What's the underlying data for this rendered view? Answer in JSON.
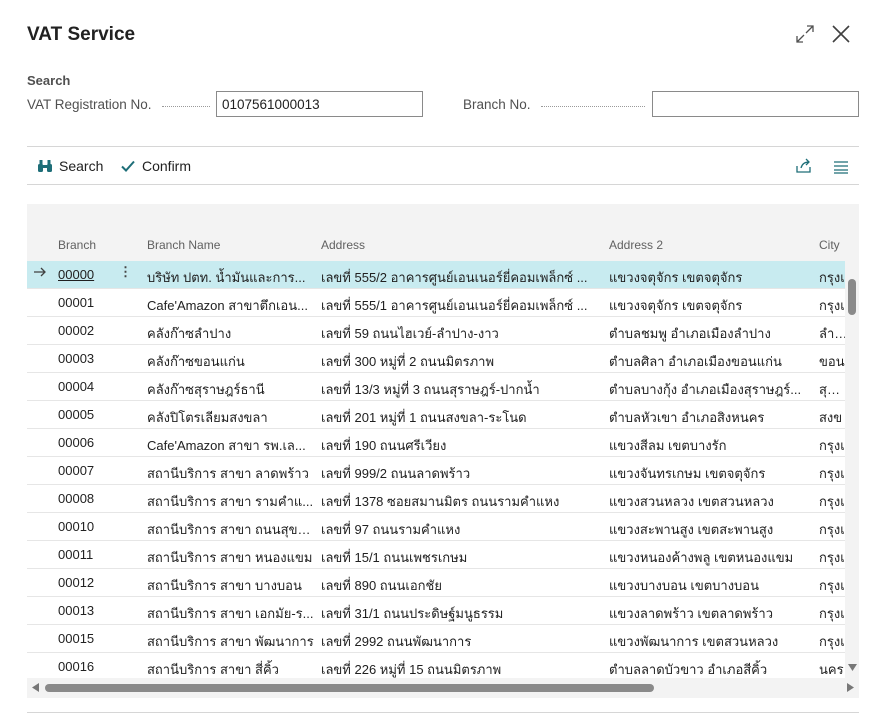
{
  "dialog": {
    "title": "VAT Service"
  },
  "search": {
    "section_label": "Search",
    "vat_label": "VAT Registration No.",
    "vat_value": "0107561000013",
    "branch_label": "Branch No.",
    "branch_value": ""
  },
  "actions": {
    "search_label": "Search",
    "confirm_label": "Confirm"
  },
  "columns": {
    "branch": "Branch",
    "branch_name": "Branch Name",
    "address": "Address",
    "address2": "Address 2",
    "city": "City"
  },
  "rows": [
    {
      "branch": "00000",
      "name": "บริษัท ปตท. น้ำมันและการ...",
      "address": "เลขที่ 555/2 อาคารศูนย์เอนเนอร์ยี่คอมเพล็กซ์ ...",
      "address2": "แขวงจตุจักร เขตจตุจักร",
      "city": "กรุงเ"
    },
    {
      "branch": "00001",
      "name": "Cafe'Amazon สาขาตึกเอน...",
      "address": "เลขที่ 555/1 อาคารศูนย์เอนเนอร์ยี่คอมเพล็กซ์ ...",
      "address2": "แขวงจตุจักร เขตจตุจักร",
      "city": "กรุงเ"
    },
    {
      "branch": "00002",
      "name": "คลังก๊าซลำปาง",
      "address": "เลขที่ 59 ถนนไฮเวย์-ลำปาง-งาว",
      "address2": "ตำบลชมพู อำเภอเมืองลำปาง",
      "city": "ลำปา"
    },
    {
      "branch": "00003",
      "name": "คลังก๊าซขอนแก่น",
      "address": "เลขที่ 300 หมู่ที่ 2 ถนนมิตรภาพ",
      "address2": "ตำบลศิลา อำเภอเมืองขอนแก่น",
      "city": "ขอน"
    },
    {
      "branch": "00004",
      "name": "คลังก๊าซสุราษฎร์ธานี",
      "address": "เลขที่ 13/3 หมู่ที่ 3 ถนนสุราษฎร์-ปากน้ำ",
      "address2": "ตำบลบางกุ้ง อำเภอเมืองสุราษฎร์...",
      "city": "สุราษ"
    },
    {
      "branch": "00005",
      "name": "คลังปิโตรเลียมสงขลา",
      "address": "เลขที่ 201 หมู่ที่ 1 ถนนสงขลา-ระโนด",
      "address2": "ตำบลหัวเขา อำเภอสิงหนคร",
      "city": "สงข"
    },
    {
      "branch": "00006",
      "name": "Cafe'Amazon สาขา รพ.เล...",
      "address": "เลขที่ 190 ถนนศรีเวียง",
      "address2": "แขวงสีลม เขตบางรัก",
      "city": "กรุงเ"
    },
    {
      "branch": "00007",
      "name": "สถานีบริการ สาขา ลาดพร้าว",
      "address": "เลขที่ 999/2 ถนนลาดพร้าว",
      "address2": "แขวงจันทรเกษม เขตจตุจักร",
      "city": "กรุงเ"
    },
    {
      "branch": "00008",
      "name": "สถานีบริการ สาขา รามคำแ...",
      "address": "เลขที่ 1378 ซอยสมานมิตร ถนนรามคำแหง",
      "address2": "แขวงสวนหลวง เขตสวนหลวง",
      "city": "กรุงเ"
    },
    {
      "branch": "00010",
      "name": "สถานีบริการ สาขา ถนนสุขา...",
      "address": "เลขที่ 97 ถนนรามคำแหง",
      "address2": "แขวงสะพานสูง เขตสะพานสูง",
      "city": "กรุงเ"
    },
    {
      "branch": "00011",
      "name": "สถานีบริการ สาขา หนองแขม",
      "address": "เลขที่ 15/1 ถนนเพชรเกษม",
      "address2": "แขวงหนองค้างพลู เขตหนองแขม",
      "city": "กรุงเ"
    },
    {
      "branch": "00012",
      "name": "สถานีบริการ สาขา บางบอน",
      "address": "เลขที่ 890 ถนนเอกชัย",
      "address2": "แขวงบางบอน เขตบางบอน",
      "city": "กรุงเ"
    },
    {
      "branch": "00013",
      "name": "สถานีบริการ สาขา เอกมัย-ร...",
      "address": "เลขที่ 31/1 ถนนประดิษฐ์มนูธรรม",
      "address2": "แขวงลาดพร้าว เขตลาดพร้าว",
      "city": "กรุงเ"
    },
    {
      "branch": "00015",
      "name": "สถานีบริการ สาขา พัฒนาการ",
      "address": "เลขที่ 2992 ถนนพัฒนาการ",
      "address2": "แขวงพัฒนาการ เขตสวนหลวง",
      "city": "กรุงเ"
    },
    {
      "branch": "00016",
      "name": "สถานีบริการ สาขา สี่คิ้ว",
      "address": "เลขที่ 226 หมู่ที่ 15 ถนนมิตรภาพ",
      "address2": "ตำบลลาดบัวขาว อำเภอสีคิ้ว",
      "city": "นคร"
    }
  ],
  "icons": {
    "expand": "expand-icon",
    "close": "close-icon",
    "search": "binoculars-icon",
    "confirm": "check-icon",
    "share": "share-icon",
    "list": "list-icon",
    "row_arrow": "arrow-right-icon",
    "row_menu": "more-vertical-icon"
  },
  "colors": {
    "selected_row": "#c8ebf0",
    "accent": "#00838f"
  }
}
